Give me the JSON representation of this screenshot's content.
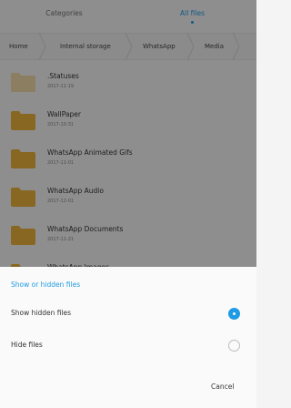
{
  "tabs": [
    {
      "label": "Categories",
      "active": false
    },
    {
      "label": "All files",
      "active": true
    }
  ],
  "breadcrumb": [
    "Home",
    "Internal storage",
    "WhatsApp",
    "Media"
  ],
  "files": [
    {
      "name": ".Statuses",
      "date": "2017-11-19",
      "hidden": true
    },
    {
      "name": "WallPaper",
      "date": "2017-10-31",
      "hidden": false
    },
    {
      "name": "WhatsApp Animated Gifs",
      "date": "2017-11-01",
      "hidden": false
    },
    {
      "name": "WhatsApp Audio",
      "date": "2017-12-01",
      "hidden": false
    },
    {
      "name": "WhatsApp Documents",
      "date": "2017-11-21",
      "hidden": false
    },
    {
      "name": "WhatsApp Images",
      "date": "",
      "hidden": false
    }
  ],
  "dialog": {
    "title": "Show or hidden files",
    "options": [
      {
        "label": "Show hidden files",
        "selected": true
      },
      {
        "label": "Hide files",
        "selected": false
      }
    ],
    "cancel_label": "Cancel"
  },
  "colors": {
    "accent": "#1e9be4",
    "folder": "#e8b23a",
    "folder_hidden": "#f1d9a6"
  },
  "icons": {
    "folder": "folder-icon",
    "radio_on": "radio-selected-icon",
    "radio_off": "radio-unselected-icon",
    "chevron": "chevron-right-icon"
  }
}
